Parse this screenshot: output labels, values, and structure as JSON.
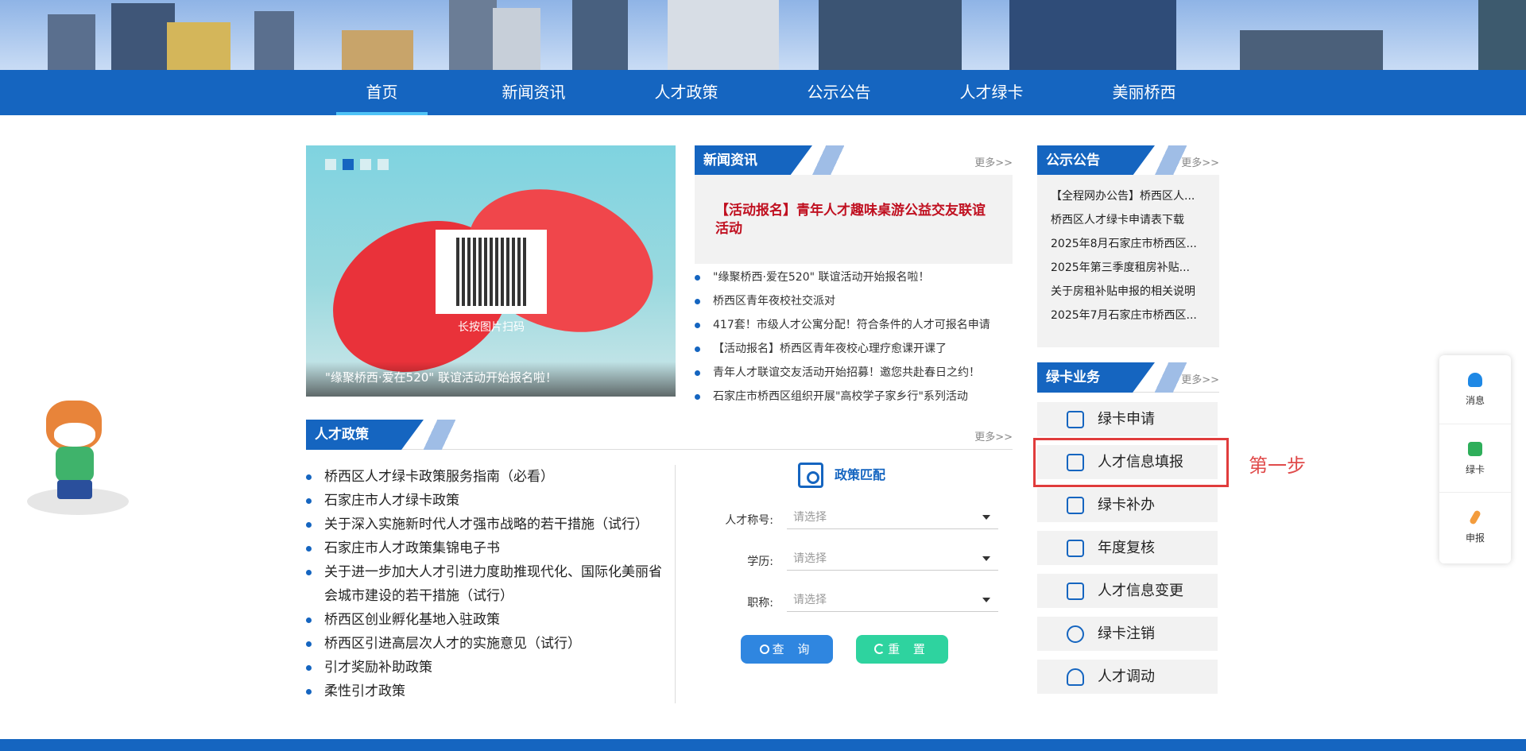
{
  "nav": {
    "items": [
      {
        "label": "首页"
      },
      {
        "label": "新闻资讯"
      },
      {
        "label": "人才政策"
      },
      {
        "label": "公示公告"
      },
      {
        "label": "人才绿卡"
      },
      {
        "label": "美丽桥西"
      }
    ]
  },
  "carousel": {
    "qr_caption": "长按图片扫码",
    "caption": "\"缘聚桥西·爱在520\" 联谊活动开始报名啦！"
  },
  "news": {
    "title": "新闻资讯",
    "more": "更多>>",
    "headline": "【活动报名】青年人才趣味桌游公益交友联谊活动",
    "items": [
      "\"缘聚桥西·爱在520\" 联谊活动开始报名啦！",
      "桥西区青年夜校社交派对",
      "417套！市级人才公寓分配！符合条件的人才可报名申请",
      "【活动报名】桥西区青年夜校心理疗愈课开课了",
      "青年人才联谊交友活动开始招募！邀您共赴春日之约！",
      "石家庄市桥西区组织开展\"高校学子家乡行\"系列活动"
    ]
  },
  "notice": {
    "title": "公示公告",
    "more": "更多>>",
    "items": [
      "【全程网办公告】桥西区人...",
      "桥西区人才绿卡申请表下载",
      "2025年8月石家庄市桥西区...",
      "2025年第三季度租房补贴...",
      "关于房租补贴申报的相关说明",
      "2025年7月石家庄市桥西区..."
    ]
  },
  "greencard": {
    "title": "绿卡业务",
    "more": "更多>>",
    "items": [
      {
        "label": "绿卡申请"
      },
      {
        "label": "人才信息填报"
      },
      {
        "label": "绿卡补办"
      },
      {
        "label": "年度复核"
      },
      {
        "label": "人才信息变更"
      },
      {
        "label": "绿卡注销"
      },
      {
        "label": "人才调动"
      }
    ],
    "step_label": "第一步"
  },
  "policy": {
    "title": "人才政策",
    "more": "更多>>",
    "items": [
      "桥西区人才绿卡政策服务指南（必看）",
      "石家庄市人才绿卡政策",
      "关于深入实施新时代人才强市战略的若干措施（试行）",
      "石家庄市人才政策集锦电子书",
      "关于进一步加大人才引进力度助推现代化、国际化美丽省会城市建设的若干措施（试行）",
      "桥西区创业孵化基地入驻政策",
      "桥西区引进高层次人才的实施意见（试行）",
      "引才奖励补助政策",
      "柔性引才政策"
    ]
  },
  "match": {
    "title": "政策匹配",
    "fields": [
      {
        "label": "人才称号:",
        "placeholder": "请选择"
      },
      {
        "label": "学历:",
        "placeholder": "请选择"
      },
      {
        "label": "职称:",
        "placeholder": "请选择"
      }
    ],
    "query_label": "查 询",
    "reset_label": "重 置"
  },
  "floatbar": {
    "items": [
      {
        "label": "消息",
        "icon": "bell-icon"
      },
      {
        "label": "绿卡",
        "icon": "card-icon"
      },
      {
        "label": "申报",
        "icon": "pencil-icon"
      }
    ]
  },
  "colors": {
    "primary": "#1565c0",
    "accent_red": "#c01020",
    "highlight": "#e03c3c",
    "reset_green": "#2ed39f",
    "query_blue": "#2f86e0"
  }
}
